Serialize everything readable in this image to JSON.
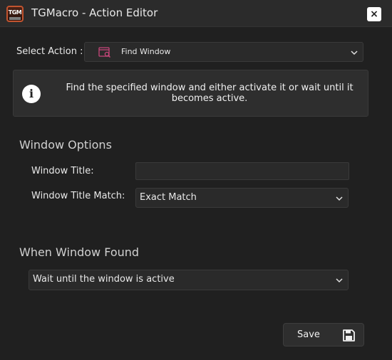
{
  "window": {
    "logo_text": "TGM",
    "title": "TGMacro - Action Editor",
    "close_label": "×"
  },
  "select_action": {
    "label": "Select Action :",
    "value": "Find Window",
    "icon": "find-window-icon"
  },
  "info": {
    "icon_label": "i",
    "text": "Find the specified window and either activate it or wait until it becomes active."
  },
  "window_options": {
    "heading": "Window Options",
    "title_label": "Window Title:",
    "title_value": "",
    "match_label": "Window Title Match:",
    "match_value": "Exact Match"
  },
  "when_found": {
    "heading": "When Window Found",
    "value": "Wait until the window is active"
  },
  "footer": {
    "save_label": "Save",
    "save_icon": "floppy-disk-icon"
  },
  "colors": {
    "background": "#202020",
    "titlebar": "#2b2b2b",
    "accent_pink": "#c8467a",
    "logo_orange": "#c2542f"
  }
}
